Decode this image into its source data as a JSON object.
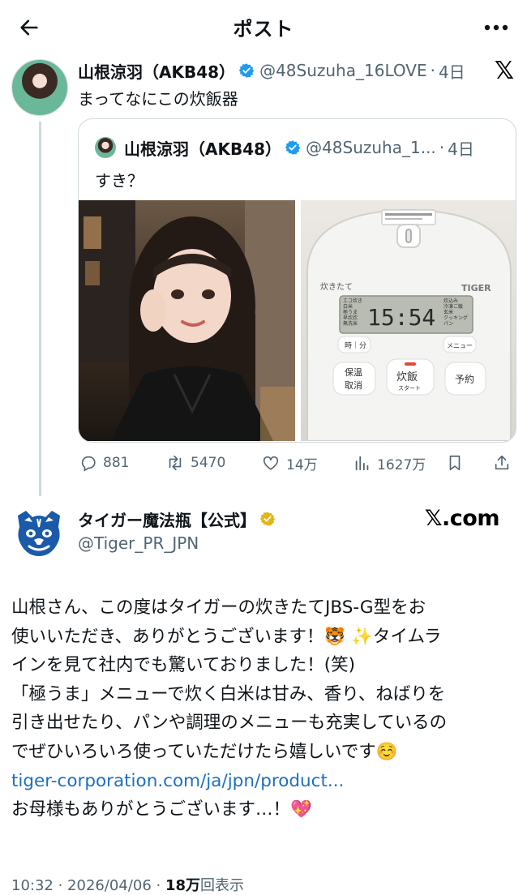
{
  "header": {
    "title": "ポスト",
    "back_icon": "arrow-left-icon",
    "more_icon": "more-horizontal-icon"
  },
  "tweet": {
    "name": "山根涼羽（AKB48）",
    "handle": "@48Suzuha_16LOVE",
    "time": "4日",
    "text": "まってなにこの炊飯器",
    "quote": {
      "name": "山根涼羽（AKB48）",
      "handle": "@48Suzuha_1...",
      "time": "4日",
      "text": "すき？",
      "rice_cooker": {
        "display_time": "15:54",
        "brand": "TIGER",
        "left_menu": [
          "エコ炊き",
          "白米",
          "極うま",
          "早炊炊",
          "無洗米"
        ],
        "right_menu": [
          "炊込み",
          "冷凍ご飯",
          "玄米",
          "クッキング",
          "パン"
        ],
        "btn_time": "時｜分",
        "btn_menu": "メニュー",
        "btn_keep": "保温\n取消",
        "btn_cook": "炊飯",
        "btn_cook_sub": "スタート",
        "btn_reserve": "予約"
      }
    },
    "stats": {
      "replies": "881",
      "reposts": "5470",
      "likes": "14万",
      "views": "1627万"
    }
  },
  "reply": {
    "name": "タイガー魔法瓶【公式】",
    "handle": "@Tiger_PR_JPN",
    "source": "𝕏.com",
    "lines": [
      "山根さん、この度はタイガーの炊きたてJBS-G型をお",
      "使いいただき、ありがとうございます！🐯 ✨タイムラ",
      "インを見て社内でも驚いておりました！(笑)",
      "「極うま」メニューで炊く白米は甘み、香り、ねばりを",
      "引き出せたり、パンや調理のメニューも充実しているの",
      "でぜひいろいろ使っていただけたら嬉しいです☺️"
    ],
    "link": "tiger-corporation.com/ja/jpn/product...",
    "last_line": "お母様もありがとうございます…！💖",
    "posted": "10:32 · 2026/04/06 · ",
    "views_count": "18万",
    "views_label": "回表示"
  },
  "colors": {
    "accent": "#1d9bf0",
    "gold": "#e2b719",
    "muted": "#536471",
    "link": "#1d6fbf",
    "border": "#cfd9de"
  }
}
